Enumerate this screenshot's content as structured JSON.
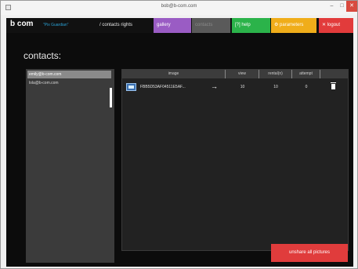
{
  "window": {
    "title": "bob@b-com.com",
    "minimize": "–",
    "maximize": "□",
    "close": "✕"
  },
  "app": {
    "logo": "b com",
    "tagline": "\"Pix Guardian\"",
    "nav": {
      "contacts_rights": "/ contacts rights",
      "gallery": "gallery",
      "contacts": "contacts",
      "help": "[?] help",
      "parameters": "⚙ parameters",
      "logout": "✕ logout"
    }
  },
  "page": {
    "title": "contacts:"
  },
  "contacts": [
    {
      "email": "emily@b-com.com",
      "selected": true
    },
    {
      "email": "lola@b-com.com",
      "selected": false
    }
  ],
  "table": {
    "columns": [
      "image",
      "view",
      "rental(n)",
      "attempt",
      ""
    ],
    "rows": [
      {
        "image_id": "FBB5D53AF04511E5AF...",
        "action_icon": "arrow-right-icon",
        "view": "10",
        "rental": "10",
        "attempt": "0",
        "delete_icon": "trash-icon"
      }
    ]
  },
  "actions": {
    "unshare_all": "unshare all pictures"
  },
  "colors": {
    "gallery": "#9a5cc4",
    "help": "#2bb34a",
    "parameters": "#f0ad1a",
    "logout": "#e23b3b",
    "unshare": "#e03c3c"
  }
}
